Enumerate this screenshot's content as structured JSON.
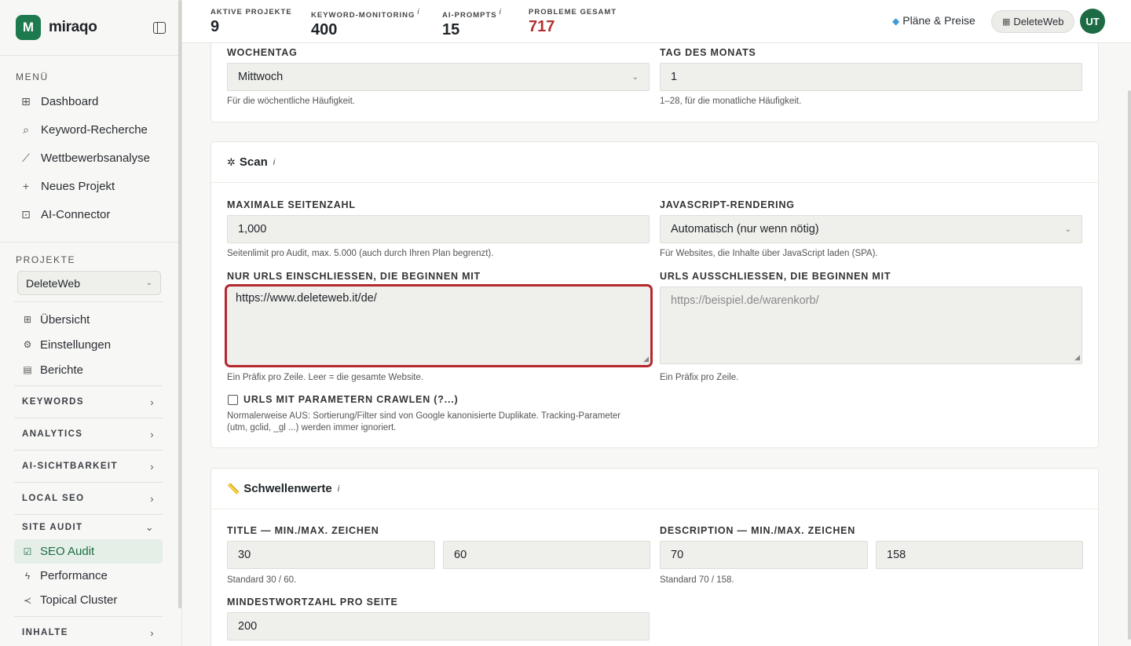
{
  "brand": {
    "name": "miraqo",
    "logo_letter": "M"
  },
  "sidebar": {
    "menu_label": "MENÜ",
    "menu": [
      {
        "label": "Dashboard",
        "icon": "grid-icon"
      },
      {
        "label": "Keyword-Recherche",
        "icon": "search-icon"
      },
      {
        "label": "Wettbewerbsanalyse",
        "icon": "chart-line-icon"
      },
      {
        "label": "Neues Projekt",
        "icon": "plus-icon"
      },
      {
        "label": "AI-Connector",
        "icon": "robot-icon"
      }
    ],
    "projects_label": "PROJEKTE",
    "project_selected": "DeleteWeb",
    "project_menu": [
      {
        "label": "Übersicht",
        "icon": "grid-icon"
      },
      {
        "label": "Einstellungen",
        "icon": "gear-icon"
      },
      {
        "label": "Berichte",
        "icon": "document-icon"
      }
    ],
    "groups": [
      "KEYWORDS",
      "ANALYTICS",
      "AI-SICHTBARKEIT",
      "LOCAL SEO"
    ],
    "site_audit_label": "SITE AUDIT",
    "site_audit_items": [
      {
        "label": "SEO Audit",
        "icon": "checkbox-icon",
        "active": true
      },
      {
        "label": "Performance",
        "icon": "bolt-icon"
      },
      {
        "label": "Topical Cluster",
        "icon": "share-icon"
      }
    ],
    "last_group": "INHALTE"
  },
  "topbar": {
    "stats": [
      {
        "label": "AKTIVE PROJEKTE",
        "value": "9",
        "info": false
      },
      {
        "label": "KEYWORD-MONITORING",
        "value": "400",
        "info": true
      },
      {
        "label": "AI-PROMPTS",
        "value": "15",
        "info": true
      },
      {
        "label": "PROBLEME GESAMT",
        "value": "717",
        "info": false,
        "color": "#b3302f"
      }
    ],
    "plans_label": "Pläne & Preise",
    "workspace_label": "DeleteWeb",
    "avatar_initials": "UT",
    "info_mark": "i"
  },
  "schedule": {
    "weekday_label": "WOCHENTAG",
    "weekday_value": "Mittwoch",
    "weekday_hint": "Für die wöchentliche Häufigkeit.",
    "monthday_label": "TAG DES MONATS",
    "monthday_value": "1",
    "monthday_hint": "1–28, für die monatliche Häufigkeit."
  },
  "scan": {
    "title": "Scan",
    "max_pages_label": "MAXIMALE SEITENZAHL",
    "max_pages_value": "1,000",
    "max_pages_hint": "Seitenlimit pro Audit, max. 5.000 (auch durch Ihren Plan begrenzt).",
    "js_label": "JAVASCRIPT-RENDERING",
    "js_value": "Automatisch (nur wenn nötig)",
    "js_hint": "Für Websites, die Inhalte über JavaScript laden (SPA).",
    "include_label": "NUR URLS EINSCHLIESSEN, DIE BEGINNEN MIT",
    "include_value": "https://www.deleteweb.it/de/",
    "include_hint": "Ein Präfix pro Zeile. Leer = die gesamte Website.",
    "exclude_label": "URLS AUSSCHLIESSEN, DIE BEGINNEN MIT",
    "exclude_placeholder": "https://beispiel.de/warenkorb/",
    "exclude_hint": "Ein Präfix pro Zeile.",
    "params_label": "URLS MIT PARAMETERN CRAWLEN (?...)",
    "params_checked": false,
    "params_hint_1": "Normalerweise AUS: Sortierung/Filter sind von Google kanonisierte Duplikate. Tracking-Parameter",
    "params_hint_2": "(utm, gclid, _gl ...) werden immer ignoriert."
  },
  "thresholds": {
    "title": "Schwellenwerte",
    "title_label": "TITLE — MIN./MAX. ZEICHEN",
    "title_min": "30",
    "title_max": "60",
    "title_hint": "Standard 30 / 60.",
    "desc_label": "DESCRIPTION — MIN./MAX. ZEICHEN",
    "desc_min": "70",
    "desc_max": "158",
    "desc_hint": "Standard 70 / 158.",
    "words_label": "MINDESTWORTZAHL PRO SEITE",
    "words_value": "200"
  },
  "colors": {
    "accent": "#1d7a4e",
    "danger": "#b5282c",
    "active_bg": "#e5efe8"
  }
}
